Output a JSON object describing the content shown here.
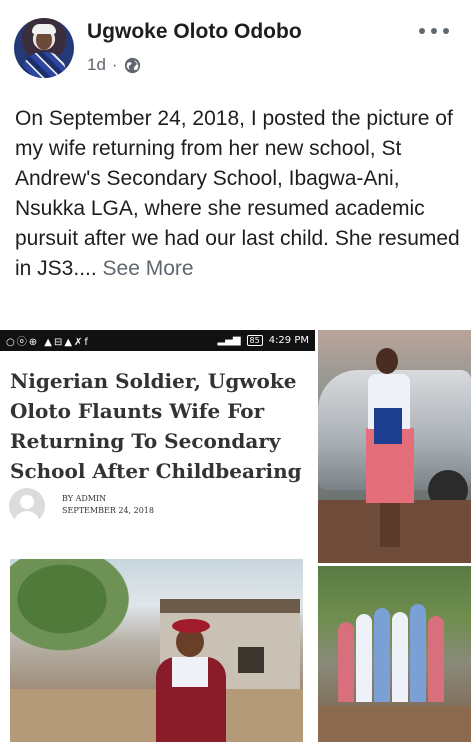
{
  "post": {
    "author_name": "Ugwoke Oloto Odobo",
    "timestamp": "1d",
    "separator": "·",
    "privacy_icon": "globe-icon",
    "more_icon": "more-dots-icon",
    "text": "On September 24, 2018, I posted the picture of my wife returning from her new school, St Andrew's Secondary School, Ibagwa-Ani, Nsukka LGA, where she resumed academic pursuit after we had our last child. She resumed in JS3....",
    "see_more_label": "See More"
  },
  "screenshot_photo": {
    "status_icons": "○ⓞ⊕ ▲⊟▲✗f",
    "status_time": "4:29 PM",
    "status_battery": "85",
    "article_title": "Nigerian Soldier, Ugwoke Oloto Flaunts Wife For Returning To Secondary School After Childbearing",
    "byline_author": "BY ADMIN",
    "byline_date": "SEPTEMBER 24, 2018"
  },
  "colors": {
    "text_primary": "#1c1e21",
    "text_secondary": "#606770",
    "background": "#ffffff"
  }
}
